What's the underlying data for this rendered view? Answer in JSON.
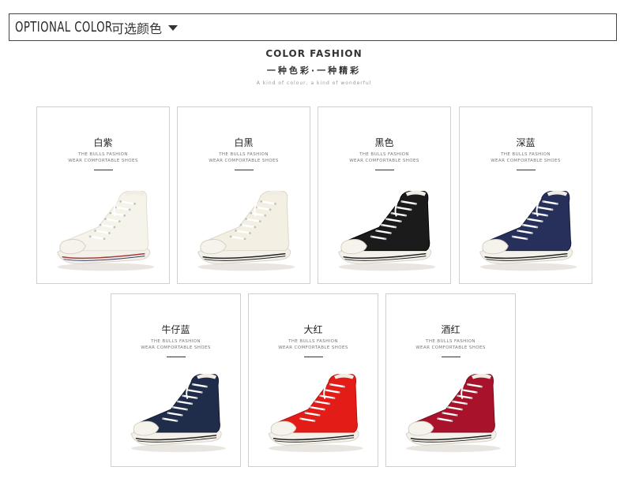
{
  "header": {
    "title_en": "OPTIONAL COLOR",
    "title_cn": "可选颜色"
  },
  "brand": {
    "title": "COLOR FASHION",
    "subtitle": "一种色彩·一种精彩",
    "tagline": "A kind of colour, a kind of wonderful"
  },
  "cards": [
    {
      "name": "白紫",
      "line1": "THE BULLS FASHION",
      "line2": "WEAR COMFORTABLE SHOES",
      "upper": "#f6f3ea",
      "upper_dark": "#e4ded0",
      "stripe": "#a33b3b",
      "stripe2": "#3c3c6c"
    },
    {
      "name": "白黑",
      "line1": "THE BULLS FASHION",
      "line2": "WEAR COMFORTABLE SHOES",
      "upper": "#f3efe3",
      "upper_dark": "#ded7c6",
      "stripe": "#222222",
      "stripe2": "#222222"
    },
    {
      "name": "黑色",
      "line1": "THE BULLS FASHION",
      "line2": "WEAR COMFORTABLE SHOES",
      "upper": "#1b1b1b",
      "upper_dark": "#000000",
      "stripe": "#222222",
      "stripe2": "#222222"
    },
    {
      "name": "深蓝",
      "line1": "THE BULLS FASHION",
      "line2": "WEAR COMFORTABLE SHOES",
      "upper": "#27305a",
      "upper_dark": "#161c3c",
      "stripe": "#222222",
      "stripe2": "#222222"
    },
    {
      "name": "牛仔蓝",
      "line1": "THE BULLS FASHION",
      "line2": "WEAR COMFORTABLE SHOES",
      "upper": "#1f2d4a",
      "upper_dark": "#111a30",
      "stripe": "#222222",
      "stripe2": "#222222"
    },
    {
      "name": "大红",
      "line1": "THE BULLS FASHION",
      "line2": "WEAR COMFORTABLE SHOES",
      "upper": "#e41c17",
      "upper_dark": "#b80f0c",
      "stripe": "#222222",
      "stripe2": "#222222"
    },
    {
      "name": "酒红",
      "line1": "THE BULLS FASHION",
      "line2": "WEAR COMFORTABLE SHOES",
      "upper": "#a8132b",
      "upper_dark": "#7a0b1d",
      "stripe": "#222222",
      "stripe2": "#222222"
    }
  ]
}
